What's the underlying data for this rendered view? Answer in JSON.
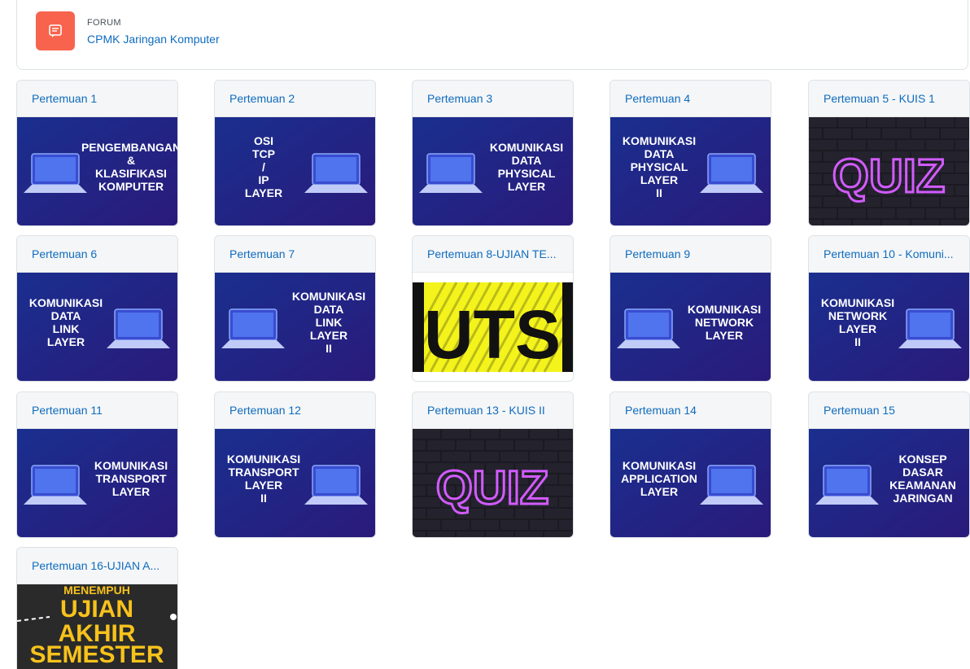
{
  "forum": {
    "type_label": "FORUM",
    "title": "CPMK Jaringan Komputer",
    "icon": "forum-chat-icon",
    "icon_color": "#f7634d"
  },
  "tiles": [
    {
      "label": "Pertemuan 1",
      "banner": "PENGEMBANGAN & KLASIFIKASI KOMPUTER"
    },
    {
      "label": "Pertemuan 2",
      "banner": "OSI TCP / IP LAYER"
    },
    {
      "label": "Pertemuan 3",
      "banner": "KOMUNIKASI DATA PHYSICAL LAYER"
    },
    {
      "label": "Pertemuan 4",
      "banner": "KOMUNIKASI DATA PHYSICAL LAYER II"
    },
    {
      "label": "Pertemuan 5 - KUIS 1",
      "banner": "QUIZ"
    },
    {
      "label": "Pertemuan 6",
      "banner": "KOMUNIKASI DATA LINK LAYER"
    },
    {
      "label": "Pertemuan 7",
      "banner": "KOMUNIKASI DATA LINK LAYER II"
    },
    {
      "label": "Pertemuan 8-UJIAN TE...",
      "banner": "UTS"
    },
    {
      "label": "Pertemuan 9",
      "banner": "KOMUNIKASI NETWORK LAYER"
    },
    {
      "label": "Pertemuan 10 - Komuni...",
      "banner": "KOMUNIKASI NETWORK LAYER II"
    },
    {
      "label": "Pertemuan 11",
      "banner": "KOMUNIKASI TRANSPORT LAYER"
    },
    {
      "label": "Pertemuan 12",
      "banner": "KOMUNIKASI TRANSPORT LAYER II"
    },
    {
      "label": "Pertemuan 13 - KUIS II",
      "banner": "QUIZ"
    },
    {
      "label": "Pertemuan 14",
      "banner": "KOMUNIKASI APPLICATION LAYER"
    },
    {
      "label": "Pertemuan 15",
      "banner": "KONSEP DASAR KEAMANAN JARINGAN"
    },
    {
      "label": "Pertemuan 16-UJIAN A...",
      "banner": "MENEMPUH UJIAN AKHIR SEMESTER"
    }
  ],
  "colors": {
    "link": "#0f6cbf",
    "banner_bg": "#1a2f8f",
    "quiz_neon": "#d25bff",
    "uts_yellow": "#f4f41c"
  }
}
